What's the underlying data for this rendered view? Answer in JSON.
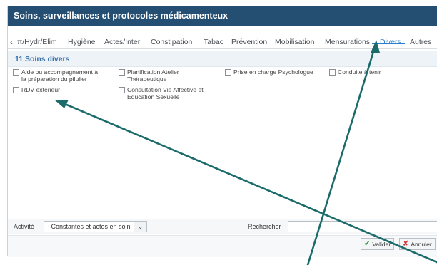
{
  "window": {
    "title": "Soins, surveillances et protocoles médicamenteux",
    "close_icon": "×"
  },
  "tabs": {
    "scroll_left_icon": "‹",
    "items": [
      {
        "label": "π/Hydr/Elim"
      },
      {
        "label": "Hygiène"
      },
      {
        "label": "Actes/Inter"
      },
      {
        "label": "Constipation"
      },
      {
        "label": "Tabac"
      },
      {
        "label": "Prévention"
      },
      {
        "label": "Mobilisation"
      },
      {
        "label": "Mensurations"
      },
      {
        "label": "Divers"
      },
      {
        "label": "Autres"
      }
    ],
    "active": "Divers"
  },
  "section": {
    "title": "11 Soins divers"
  },
  "care_items": [
    {
      "label": "Aide ou accompagnement à\nla préparation du pilulier",
      "checked": false
    },
    {
      "label": "Planification Atelier\nThérapeutique",
      "checked": false
    },
    {
      "label": "Prise en charge Psychologue",
      "checked": false
    },
    {
      "label": "Conduite à tenir",
      "checked": false
    },
    {
      "label": "RDV extérieur",
      "checked": false
    },
    {
      "label": "Consultation Vie Affective et\nEducation Sexuelle",
      "checked": false
    }
  ],
  "filters": {
    "activite_label": "Activité",
    "activite_value": "- Constantes et actes en soin",
    "dropdown_icon": "⌄",
    "search_label": "Rechercher",
    "search_value": ""
  },
  "footer": {
    "validate_label": "Valider",
    "validate_icon": "✔",
    "cancel_label": "Annuler",
    "cancel_icon": "✘"
  },
  "colors": {
    "titlebar": "#244f73",
    "accent": "#2a7fd0",
    "annotation_arrow": "#1c6b6b"
  }
}
